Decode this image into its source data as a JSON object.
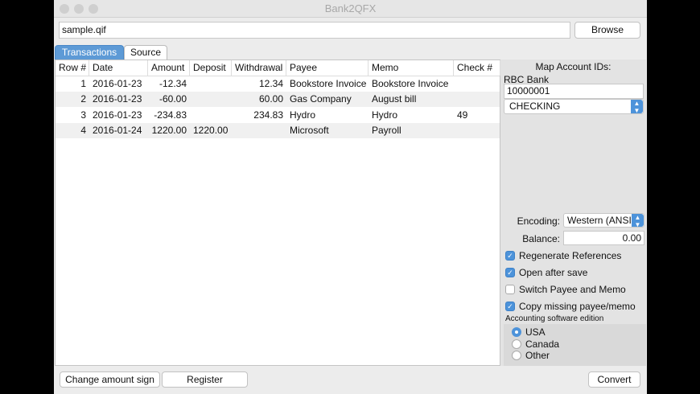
{
  "window": {
    "title": "Bank2QFX"
  },
  "file": {
    "path": "sample.qif",
    "browse_label": "Browse"
  },
  "tabs": [
    {
      "label": "Transactions",
      "active": true
    },
    {
      "label": "Source",
      "active": false
    }
  ],
  "table": {
    "columns": [
      "Row #",
      "Date",
      "Amount",
      "Deposit",
      "Withdrawal",
      "Payee",
      "Memo",
      "Check #"
    ],
    "rows": [
      [
        "1",
        "2016-01-23",
        "-12.34",
        "",
        "12.34",
        "Bookstore Invoice",
        "Bookstore Invoice",
        ""
      ],
      [
        "2",
        "2016-01-23",
        "-60.00",
        "",
        "60.00",
        "Gas Company",
        "August bill",
        ""
      ],
      [
        "3",
        "2016-01-23",
        "-234.83",
        "",
        "234.83",
        "Hydro",
        "Hydro",
        "49"
      ],
      [
        "4",
        "2016-01-24",
        "1220.00",
        "1220.00",
        "",
        "Microsoft",
        "Payroll",
        ""
      ]
    ]
  },
  "panel": {
    "map_title": "Map Account IDs:",
    "bank_name": "RBC Bank",
    "account_id": "10000001",
    "account_type": "CHECKING",
    "encoding_label": "Encoding:",
    "encoding_value": "Western (ANSI)",
    "balance_label": "Balance:",
    "balance_value": "0.00",
    "checkboxes": [
      {
        "label": "Regenerate References",
        "checked": true
      },
      {
        "label": "Open after save",
        "checked": true
      },
      {
        "label": "Switch Payee and Memo",
        "checked": false
      },
      {
        "label": "Copy missing payee/memo",
        "checked": true
      }
    ],
    "edition_label": "Accounting software edition",
    "editions": [
      {
        "label": "USA",
        "selected": true
      },
      {
        "label": "Canada",
        "selected": false
      },
      {
        "label": "Other",
        "selected": false
      }
    ]
  },
  "footer": {
    "change_sign_label": "Change amount sign",
    "register_label": "Register",
    "convert_label": "Convert"
  },
  "colors": {
    "accent": "#4d93da"
  }
}
